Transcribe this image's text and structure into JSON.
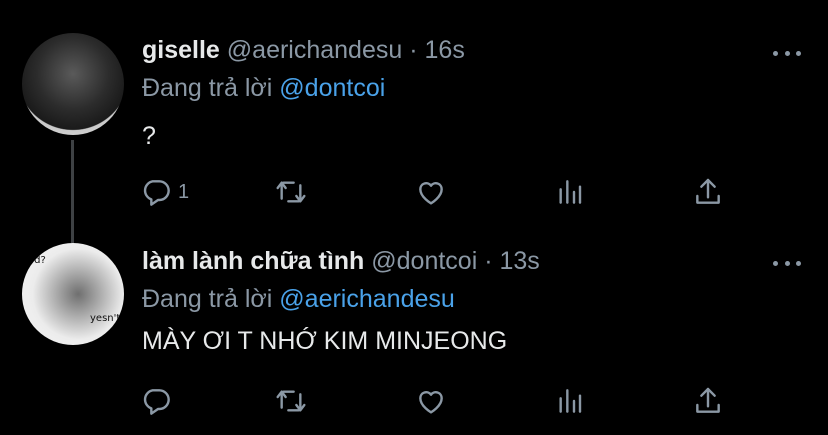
{
  "tweets": [
    {
      "display_name": "giselle",
      "handle": "@aerichandesu",
      "separator": "·",
      "time": "16s",
      "reply_prefix": "Đang trả lời",
      "reply_to": "@dontcoi",
      "text": "?",
      "reply_count": "1"
    },
    {
      "display_name": "làm lành chữa tình",
      "handle": "@dontcoi",
      "separator": "·",
      "time": "13s",
      "reply_prefix": "Đang trả lời",
      "reply_to": "@aerichandesu",
      "text": "MÀY ƠI T NHỚ KIM MINJEONG",
      "avatar_scribbles": [
        "od?",
        "yesn't"
      ]
    }
  ],
  "icons": [
    "comment-icon",
    "retweet-icon",
    "like-icon",
    "analytics-icon",
    "share-icon",
    "more-icon"
  ],
  "colors": {
    "background": "#000000",
    "text": "#e7e9ea",
    "secondary": "#8b98a5",
    "mention": "#4aa2e9"
  }
}
